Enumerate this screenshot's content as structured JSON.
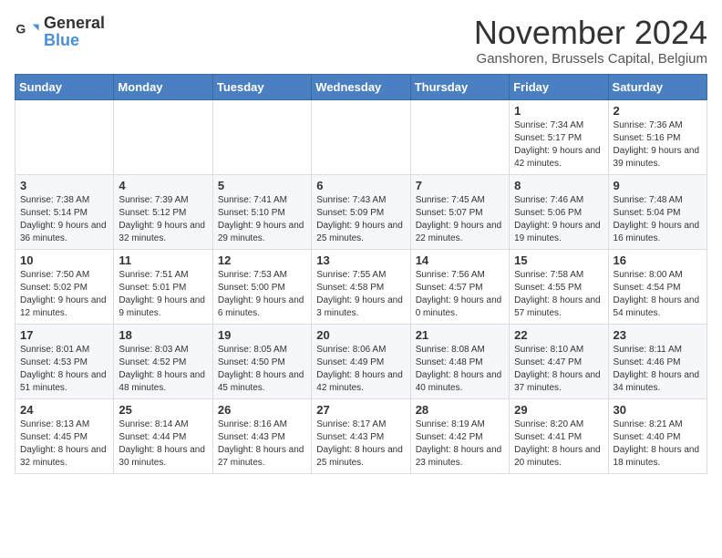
{
  "logo": {
    "text_general": "General",
    "text_blue": "Blue"
  },
  "title": "November 2024",
  "location": "Ganshoren, Brussels Capital, Belgium",
  "days_of_week": [
    "Sunday",
    "Monday",
    "Tuesday",
    "Wednesday",
    "Thursday",
    "Friday",
    "Saturday"
  ],
  "weeks": [
    [
      {
        "day": "",
        "info": ""
      },
      {
        "day": "",
        "info": ""
      },
      {
        "day": "",
        "info": ""
      },
      {
        "day": "",
        "info": ""
      },
      {
        "day": "",
        "info": ""
      },
      {
        "day": "1",
        "info": "Sunrise: 7:34 AM\nSunset: 5:17 PM\nDaylight: 9 hours and 42 minutes."
      },
      {
        "day": "2",
        "info": "Sunrise: 7:36 AM\nSunset: 5:16 PM\nDaylight: 9 hours and 39 minutes."
      }
    ],
    [
      {
        "day": "3",
        "info": "Sunrise: 7:38 AM\nSunset: 5:14 PM\nDaylight: 9 hours and 36 minutes."
      },
      {
        "day": "4",
        "info": "Sunrise: 7:39 AM\nSunset: 5:12 PM\nDaylight: 9 hours and 32 minutes."
      },
      {
        "day": "5",
        "info": "Sunrise: 7:41 AM\nSunset: 5:10 PM\nDaylight: 9 hours and 29 minutes."
      },
      {
        "day": "6",
        "info": "Sunrise: 7:43 AM\nSunset: 5:09 PM\nDaylight: 9 hours and 25 minutes."
      },
      {
        "day": "7",
        "info": "Sunrise: 7:45 AM\nSunset: 5:07 PM\nDaylight: 9 hours and 22 minutes."
      },
      {
        "day": "8",
        "info": "Sunrise: 7:46 AM\nSunset: 5:06 PM\nDaylight: 9 hours and 19 minutes."
      },
      {
        "day": "9",
        "info": "Sunrise: 7:48 AM\nSunset: 5:04 PM\nDaylight: 9 hours and 16 minutes."
      }
    ],
    [
      {
        "day": "10",
        "info": "Sunrise: 7:50 AM\nSunset: 5:02 PM\nDaylight: 9 hours and 12 minutes."
      },
      {
        "day": "11",
        "info": "Sunrise: 7:51 AM\nSunset: 5:01 PM\nDaylight: 9 hours and 9 minutes."
      },
      {
        "day": "12",
        "info": "Sunrise: 7:53 AM\nSunset: 5:00 PM\nDaylight: 9 hours and 6 minutes."
      },
      {
        "day": "13",
        "info": "Sunrise: 7:55 AM\nSunset: 4:58 PM\nDaylight: 9 hours and 3 minutes."
      },
      {
        "day": "14",
        "info": "Sunrise: 7:56 AM\nSunset: 4:57 PM\nDaylight: 9 hours and 0 minutes."
      },
      {
        "day": "15",
        "info": "Sunrise: 7:58 AM\nSunset: 4:55 PM\nDaylight: 8 hours and 57 minutes."
      },
      {
        "day": "16",
        "info": "Sunrise: 8:00 AM\nSunset: 4:54 PM\nDaylight: 8 hours and 54 minutes."
      }
    ],
    [
      {
        "day": "17",
        "info": "Sunrise: 8:01 AM\nSunset: 4:53 PM\nDaylight: 8 hours and 51 minutes."
      },
      {
        "day": "18",
        "info": "Sunrise: 8:03 AM\nSunset: 4:52 PM\nDaylight: 8 hours and 48 minutes."
      },
      {
        "day": "19",
        "info": "Sunrise: 8:05 AM\nSunset: 4:50 PM\nDaylight: 8 hours and 45 minutes."
      },
      {
        "day": "20",
        "info": "Sunrise: 8:06 AM\nSunset: 4:49 PM\nDaylight: 8 hours and 42 minutes."
      },
      {
        "day": "21",
        "info": "Sunrise: 8:08 AM\nSunset: 4:48 PM\nDaylight: 8 hours and 40 minutes."
      },
      {
        "day": "22",
        "info": "Sunrise: 8:10 AM\nSunset: 4:47 PM\nDaylight: 8 hours and 37 minutes."
      },
      {
        "day": "23",
        "info": "Sunrise: 8:11 AM\nSunset: 4:46 PM\nDaylight: 8 hours and 34 minutes."
      }
    ],
    [
      {
        "day": "24",
        "info": "Sunrise: 8:13 AM\nSunset: 4:45 PM\nDaylight: 8 hours and 32 minutes."
      },
      {
        "day": "25",
        "info": "Sunrise: 8:14 AM\nSunset: 4:44 PM\nDaylight: 8 hours and 30 minutes."
      },
      {
        "day": "26",
        "info": "Sunrise: 8:16 AM\nSunset: 4:43 PM\nDaylight: 8 hours and 27 minutes."
      },
      {
        "day": "27",
        "info": "Sunrise: 8:17 AM\nSunset: 4:43 PM\nDaylight: 8 hours and 25 minutes."
      },
      {
        "day": "28",
        "info": "Sunrise: 8:19 AM\nSunset: 4:42 PM\nDaylight: 8 hours and 23 minutes."
      },
      {
        "day": "29",
        "info": "Sunrise: 8:20 AM\nSunset: 4:41 PM\nDaylight: 8 hours and 20 minutes."
      },
      {
        "day": "30",
        "info": "Sunrise: 8:21 AM\nSunset: 4:40 PM\nDaylight: 8 hours and 18 minutes."
      }
    ]
  ]
}
